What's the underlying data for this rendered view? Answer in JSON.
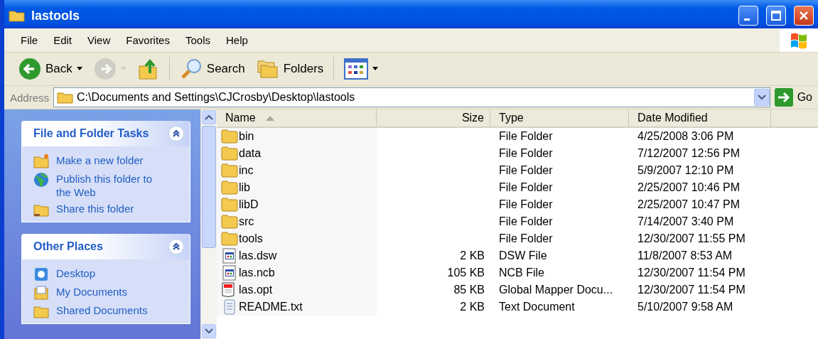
{
  "window": {
    "title": "lastools"
  },
  "menu": [
    "File",
    "Edit",
    "View",
    "Favorites",
    "Tools",
    "Help"
  ],
  "toolbar": [
    {
      "kind": "back",
      "label": "Back",
      "disabled": false
    },
    {
      "kind": "forward",
      "disabled": true
    },
    {
      "kind": "up",
      "disabled": false
    },
    {
      "kind": "search",
      "label": "Search",
      "disabled": false
    },
    {
      "kind": "folders",
      "label": "Folders",
      "disabled": false
    },
    {
      "kind": "views",
      "disabled": false
    }
  ],
  "address": {
    "label": "Address",
    "value": "C:\\Documents and Settings\\CJCrosby\\Desktop\\lastools",
    "go": "Go"
  },
  "sidebar": [
    {
      "title": "File and Folder Tasks",
      "expanded": true,
      "items": [
        {
          "kind": "newfolder",
          "label": "Make a new folder"
        },
        {
          "kind": "web",
          "label": "Publish this folder to the Web"
        },
        {
          "kind": "share",
          "label": "Share this folder"
        }
      ]
    },
    {
      "title": "Other Places",
      "expanded": true,
      "items": [
        {
          "kind": "desktop",
          "label": "Desktop"
        },
        {
          "kind": "documents",
          "label": "My Documents"
        },
        {
          "kind": "shared",
          "label": "Shared Documents"
        }
      ]
    }
  ],
  "table": {
    "columns": [
      {
        "label": "Name",
        "sorted": true
      },
      {
        "label": "Size",
        "sorted": false
      },
      {
        "label": "Type",
        "sorted": false
      },
      {
        "label": "Date Modified",
        "sorted": false
      }
    ],
    "rows": [
      {
        "kind": "folder",
        "name": "bin",
        "type": "File Folder",
        "modified": "4/25/2008 3:06 PM"
      },
      {
        "kind": "folder",
        "name": "data",
        "type": "File Folder",
        "modified": "7/12/2007 12:56 PM"
      },
      {
        "kind": "folder",
        "name": "inc",
        "type": "File Folder",
        "modified": "5/9/2007 12:10 PM"
      },
      {
        "kind": "folder",
        "name": "lib",
        "type": "File Folder",
        "modified": "2/25/2007 10:46 PM"
      },
      {
        "kind": "folder",
        "name": "libD",
        "type": "File Folder",
        "modified": "2/25/2007 10:47 PM"
      },
      {
        "kind": "folder",
        "name": "src",
        "type": "File Folder",
        "modified": "7/14/2007 3:40 PM"
      },
      {
        "kind": "folder",
        "name": "tools",
        "type": "File Folder",
        "modified": "12/30/2007 11:55 PM"
      },
      {
        "kind": "app",
        "name": "las.dsw",
        "size": "2 KB",
        "type": "DSW File",
        "modified": "11/8/2007 8:53 AM"
      },
      {
        "kind": "app",
        "name": "las.ncb",
        "size": "105 KB",
        "type": "NCB File",
        "modified": "12/30/2007 11:54 PM"
      },
      {
        "kind": "doc",
        "name": "las.opt",
        "size": "85 KB",
        "type": "Global Mapper Docu...",
        "modified": "12/30/2007 11:54 PM"
      },
      {
        "kind": "text",
        "name": "README.txt",
        "size": "2 KB",
        "type": "Text Document",
        "modified": "5/10/2007 9:58 AM"
      }
    ]
  }
}
